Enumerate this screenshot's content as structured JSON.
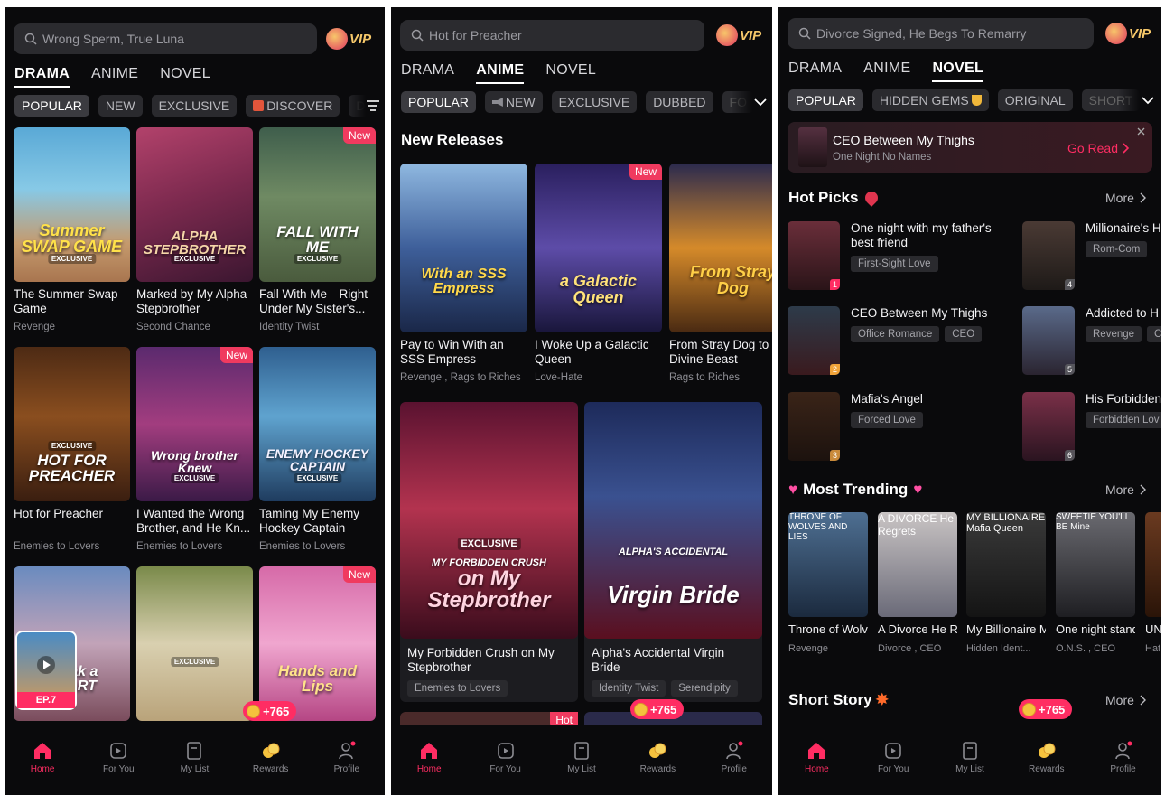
{
  "rewards_badge": "+765",
  "vip_label": "VIP",
  "nav": [
    {
      "label": "Home",
      "icon": "home-icon"
    },
    {
      "label": "For You",
      "icon": "play-card-icon"
    },
    {
      "label": "My List",
      "icon": "bookmark-list-icon"
    },
    {
      "label": "Rewards",
      "icon": "coins-icon"
    },
    {
      "label": "Profile",
      "icon": "profile-icon"
    }
  ],
  "panel1": {
    "search_placeholder": "Wrong Sperm, True Luna",
    "tabs": [
      "DRAMA",
      "ANIME",
      "NOVEL"
    ],
    "active_tab": "DRAMA",
    "chips": [
      "POPULAR",
      "NEW",
      "EXCLUSIVE",
      "DISCOVER",
      "D"
    ],
    "cards": [
      {
        "cover_text": "Summer SWAP GAME",
        "badge": "EXCLUSIVE",
        "title": "The Summer Swap Game",
        "tag": "Revenge",
        "new": false
      },
      {
        "cover_text": "ALPHA STEPBROTHER",
        "badge": "EXCLUSIVE",
        "title": "Marked by My Alpha Stepbrother",
        "tag": "Second Chance",
        "new": false
      },
      {
        "cover_text": "FALL WITH ME",
        "badge": "EXCLUSIVE",
        "title": "Fall With Me—Right Under My Sister's...",
        "tag": "Identity Twist",
        "new": true
      },
      {
        "cover_text": "HOT FOR PREACHER",
        "badge": "EXCLUSIVE",
        "title": "Hot for Preacher",
        "tag": "Enemies to Lovers",
        "new": false
      },
      {
        "cover_text": "Wrong brother Knew",
        "badge": "EXCLUSIVE",
        "title": "I Wanted the Wrong Brother, and He Kn...",
        "tag": "Enemies to Lovers",
        "new": true
      },
      {
        "cover_text": "ENEMY HOCKEY CAPTAIN",
        "badge": "EXCLUSIVE",
        "title": "Taming My Enemy Hockey Captain",
        "tag": "Enemies to Lovers",
        "new": false
      },
      {
        "cover_text": "Break a HEART",
        "badge": "",
        "title": "",
        "tag": "",
        "new": false
      },
      {
        "cover_text": "",
        "badge": "EXCLUSIVE",
        "title": "",
        "tag": "",
        "new": false
      },
      {
        "cover_text": "Hands and Lips",
        "badge": "",
        "title": "",
        "tag": "",
        "new": true
      }
    ],
    "mini_player": "EP.7",
    "new_label": "New"
  },
  "panel2": {
    "search_placeholder": "Hot for Preacher",
    "tabs": [
      "DRAMA",
      "ANIME",
      "NOVEL"
    ],
    "active_tab": "ANIME",
    "chips": [
      "POPULAR",
      "NEW",
      "EXCLUSIVE",
      "DUBBED",
      "FO"
    ],
    "section_title": "New Releases",
    "releases": [
      {
        "cover_text": "With an SSS Empress",
        "title": "Pay to Win With an SSS Empress",
        "tags": "Revenge , Rags to Riches",
        "new": false
      },
      {
        "cover_text": "a Galactic Queen",
        "title": "I Woke Up a Galactic Queen",
        "tags": "Love-Hate",
        "new": true
      },
      {
        "cover_text": "From Stray Dog",
        "title": "From Stray Dog to Divine Beast",
        "tags": "Rags to Riches",
        "new": false
      }
    ],
    "featured": [
      {
        "cover_text": "on My Stepbrother",
        "banner": "MY FORBIDDEN CRUSH",
        "badge": "EXCLUSIVE",
        "title": "My Forbidden Crush on My Stepbrother",
        "tags": [
          "Enemies to Lovers"
        ]
      },
      {
        "cover_text": "Virgin Bride",
        "banner": "ALPHA'S ACCIDENTAL",
        "badge": "",
        "title": "Alpha's Accidental Virgin Bride",
        "tags": [
          "Identity Twist",
          "Serendipity"
        ]
      }
    ],
    "hot_label": "Hot"
  },
  "panel3": {
    "search_placeholder": "Divorce Signed, He Begs To Remarry",
    "tabs": [
      "DRAMA",
      "ANIME",
      "NOVEL"
    ],
    "active_tab": "NOVEL",
    "chips": [
      "POPULAR",
      "HIDDEN GEMS",
      "ORIGINAL",
      "SHORT"
    ],
    "continue": {
      "title": "CEO Between My Thighs",
      "subtitle": "One Night No Names",
      "action": "Go Read"
    },
    "hot_picks_title": "Hot Picks",
    "more_label": "More",
    "hot_picks": [
      {
        "title": "One night with my father's best friend",
        "tags": [
          "First-Sight Love"
        ],
        "rank": "1"
      },
      {
        "title": "CEO Between My Thighs",
        "tags": [
          "Office Romance",
          "CEO"
        ],
        "rank": "2"
      },
      {
        "title": "Mafia's Angel",
        "tags": [
          "Forced Love"
        ],
        "rank": "3"
      },
      {
        "title": "Millionaire's H Secretary",
        "tags": [
          "Rom-Com",
          ""
        ],
        "rank": "4"
      },
      {
        "title": "Addicted to H One Night",
        "tags": [
          "Revenge",
          "C"
        ],
        "rank": "5"
      },
      {
        "title": "His Forbidden",
        "tags": [
          "Forbidden Lov"
        ],
        "rank": "6"
      }
    ],
    "trending_title": "Most Trending",
    "trending": [
      {
        "cover_text": "THRONE OF WOLVES AND LIES",
        "title": "Throne of Wolves and...",
        "tags": "Revenge"
      },
      {
        "cover_text": "A DIVORCE He Regrets",
        "title": "A Divorce He Regrets",
        "tags": "Divorce , CEO"
      },
      {
        "cover_text": "MY BILLIONAIRE Mafia Queen",
        "title": "My Billionaire Mafia Queen",
        "tags": "Hidden Ident..."
      },
      {
        "cover_text": "SWEETIE YOU'LL BE Mine",
        "title": "One night stand: Swee...",
        "tags": "O.N.S. , CEO"
      },
      {
        "cover_text": "",
        "title": "UN AL",
        "tags": "Hat"
      }
    ],
    "short_story_title": "Short Story"
  },
  "colors": {
    "accent": "#ff2d63",
    "background": "#0a0a0c",
    "chip": "#2a2a2e",
    "coin": "#f5c23d"
  }
}
